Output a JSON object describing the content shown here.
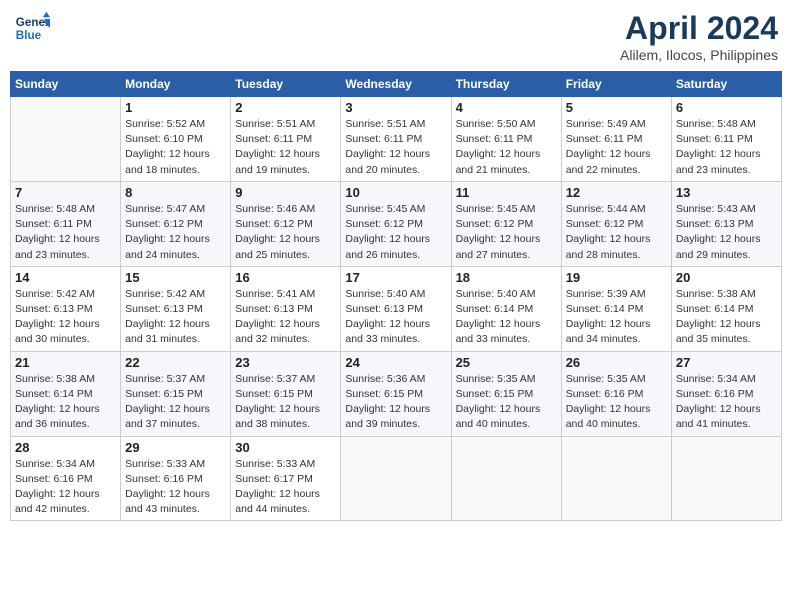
{
  "logo": {
    "line1": "General",
    "line2": "Blue"
  },
  "title": "April 2024",
  "location": "Alilem, Ilocos, Philippines",
  "days_header": [
    "Sunday",
    "Monday",
    "Tuesday",
    "Wednesday",
    "Thursday",
    "Friday",
    "Saturday"
  ],
  "weeks": [
    [
      {
        "num": "",
        "info": ""
      },
      {
        "num": "1",
        "info": "Sunrise: 5:52 AM\nSunset: 6:10 PM\nDaylight: 12 hours\nand 18 minutes."
      },
      {
        "num": "2",
        "info": "Sunrise: 5:51 AM\nSunset: 6:11 PM\nDaylight: 12 hours\nand 19 minutes."
      },
      {
        "num": "3",
        "info": "Sunrise: 5:51 AM\nSunset: 6:11 PM\nDaylight: 12 hours\nand 20 minutes."
      },
      {
        "num": "4",
        "info": "Sunrise: 5:50 AM\nSunset: 6:11 PM\nDaylight: 12 hours\nand 21 minutes."
      },
      {
        "num": "5",
        "info": "Sunrise: 5:49 AM\nSunset: 6:11 PM\nDaylight: 12 hours\nand 22 minutes."
      },
      {
        "num": "6",
        "info": "Sunrise: 5:48 AM\nSunset: 6:11 PM\nDaylight: 12 hours\nand 23 minutes."
      }
    ],
    [
      {
        "num": "7",
        "info": "Sunrise: 5:48 AM\nSunset: 6:11 PM\nDaylight: 12 hours\nand 23 minutes."
      },
      {
        "num": "8",
        "info": "Sunrise: 5:47 AM\nSunset: 6:12 PM\nDaylight: 12 hours\nand 24 minutes."
      },
      {
        "num": "9",
        "info": "Sunrise: 5:46 AM\nSunset: 6:12 PM\nDaylight: 12 hours\nand 25 minutes."
      },
      {
        "num": "10",
        "info": "Sunrise: 5:45 AM\nSunset: 6:12 PM\nDaylight: 12 hours\nand 26 minutes."
      },
      {
        "num": "11",
        "info": "Sunrise: 5:45 AM\nSunset: 6:12 PM\nDaylight: 12 hours\nand 27 minutes."
      },
      {
        "num": "12",
        "info": "Sunrise: 5:44 AM\nSunset: 6:12 PM\nDaylight: 12 hours\nand 28 minutes."
      },
      {
        "num": "13",
        "info": "Sunrise: 5:43 AM\nSunset: 6:13 PM\nDaylight: 12 hours\nand 29 minutes."
      }
    ],
    [
      {
        "num": "14",
        "info": "Sunrise: 5:42 AM\nSunset: 6:13 PM\nDaylight: 12 hours\nand 30 minutes."
      },
      {
        "num": "15",
        "info": "Sunrise: 5:42 AM\nSunset: 6:13 PM\nDaylight: 12 hours\nand 31 minutes."
      },
      {
        "num": "16",
        "info": "Sunrise: 5:41 AM\nSunset: 6:13 PM\nDaylight: 12 hours\nand 32 minutes."
      },
      {
        "num": "17",
        "info": "Sunrise: 5:40 AM\nSunset: 6:13 PM\nDaylight: 12 hours\nand 33 minutes."
      },
      {
        "num": "18",
        "info": "Sunrise: 5:40 AM\nSunset: 6:14 PM\nDaylight: 12 hours\nand 33 minutes."
      },
      {
        "num": "19",
        "info": "Sunrise: 5:39 AM\nSunset: 6:14 PM\nDaylight: 12 hours\nand 34 minutes."
      },
      {
        "num": "20",
        "info": "Sunrise: 5:38 AM\nSunset: 6:14 PM\nDaylight: 12 hours\nand 35 minutes."
      }
    ],
    [
      {
        "num": "21",
        "info": "Sunrise: 5:38 AM\nSunset: 6:14 PM\nDaylight: 12 hours\nand 36 minutes."
      },
      {
        "num": "22",
        "info": "Sunrise: 5:37 AM\nSunset: 6:15 PM\nDaylight: 12 hours\nand 37 minutes."
      },
      {
        "num": "23",
        "info": "Sunrise: 5:37 AM\nSunset: 6:15 PM\nDaylight: 12 hours\nand 38 minutes."
      },
      {
        "num": "24",
        "info": "Sunrise: 5:36 AM\nSunset: 6:15 PM\nDaylight: 12 hours\nand 39 minutes."
      },
      {
        "num": "25",
        "info": "Sunrise: 5:35 AM\nSunset: 6:15 PM\nDaylight: 12 hours\nand 40 minutes."
      },
      {
        "num": "26",
        "info": "Sunrise: 5:35 AM\nSunset: 6:16 PM\nDaylight: 12 hours\nand 40 minutes."
      },
      {
        "num": "27",
        "info": "Sunrise: 5:34 AM\nSunset: 6:16 PM\nDaylight: 12 hours\nand 41 minutes."
      }
    ],
    [
      {
        "num": "28",
        "info": "Sunrise: 5:34 AM\nSunset: 6:16 PM\nDaylight: 12 hours\nand 42 minutes."
      },
      {
        "num": "29",
        "info": "Sunrise: 5:33 AM\nSunset: 6:16 PM\nDaylight: 12 hours\nand 43 minutes."
      },
      {
        "num": "30",
        "info": "Sunrise: 5:33 AM\nSunset: 6:17 PM\nDaylight: 12 hours\nand 44 minutes."
      },
      {
        "num": "",
        "info": ""
      },
      {
        "num": "",
        "info": ""
      },
      {
        "num": "",
        "info": ""
      },
      {
        "num": "",
        "info": ""
      }
    ]
  ]
}
